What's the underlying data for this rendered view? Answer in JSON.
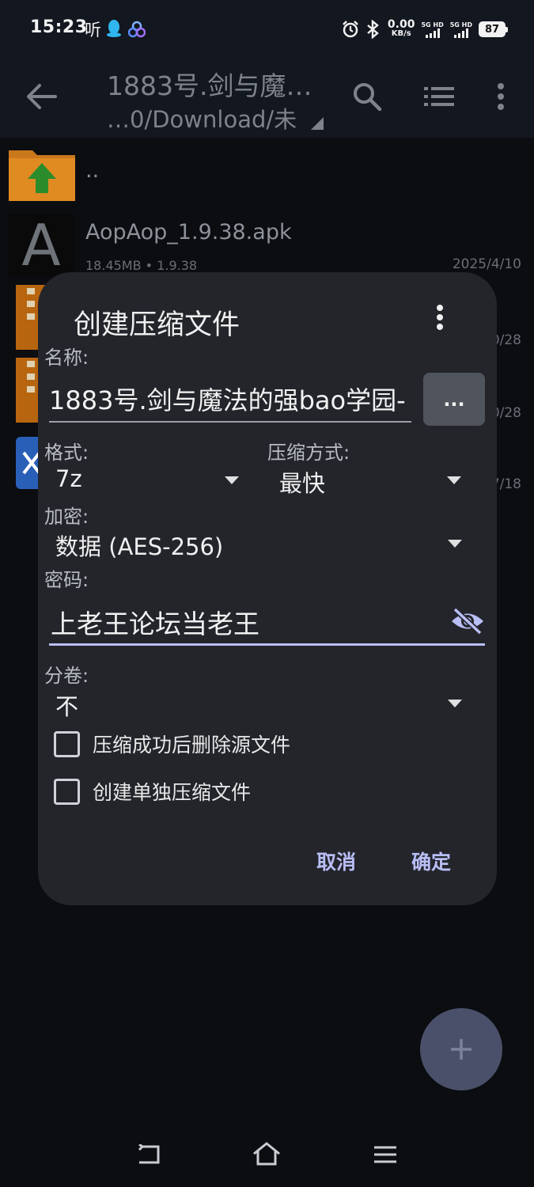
{
  "status_bar": {
    "time": "15:23",
    "extra": "听",
    "net_speed": "0.00",
    "net_unit": "KB/s",
    "sim1": "5G HD",
    "sim2": "5G HD",
    "battery": "87"
  },
  "app_bar": {
    "title": "1883号.剑与魔…",
    "path": "…0/Download/未"
  },
  "files": [
    {
      "name": "..",
      "meta": "",
      "date": "",
      "icon": "folder-up-icon"
    },
    {
      "name": "AopAop_1.9.38.apk",
      "meta": "18.45MB   • 1.9.38",
      "date": "2025/4/10",
      "icon": "apk-icon"
    },
    {
      "name": "",
      "meta": "",
      "date": "0/28",
      "icon": "archive-7z-icon"
    },
    {
      "name": "",
      "meta": "",
      "date": "0/28",
      "icon": "archive-zip-icon"
    },
    {
      "name": "",
      "meta": "",
      "date": "7/18",
      "icon": "app-icon"
    }
  ],
  "dialog": {
    "title": "创建压缩文件",
    "name_label": "名称:",
    "name_value": "1883号.剑与魔法的强bao学园-",
    "name_button": "...",
    "format_label": "格式:",
    "format_value": "7z",
    "method_label": "压缩方式:",
    "method_value": "最快",
    "encrypt_label": "加密:",
    "encrypt_value": "数据 (AES-256)",
    "password_label": "密码:",
    "password_value": "上老王论坛当老王",
    "split_label": "分卷:",
    "split_value": "不",
    "delete_source_label": "压缩成功后删除源文件",
    "delete_source_checked": false,
    "separate_label": "创建单独压缩文件",
    "separate_checked": false,
    "cancel": "取消",
    "ok": "确定"
  },
  "colors": {
    "accent": "#b9bef5",
    "dialog_bg": "#23252b",
    "fab": "#4a5069"
  }
}
